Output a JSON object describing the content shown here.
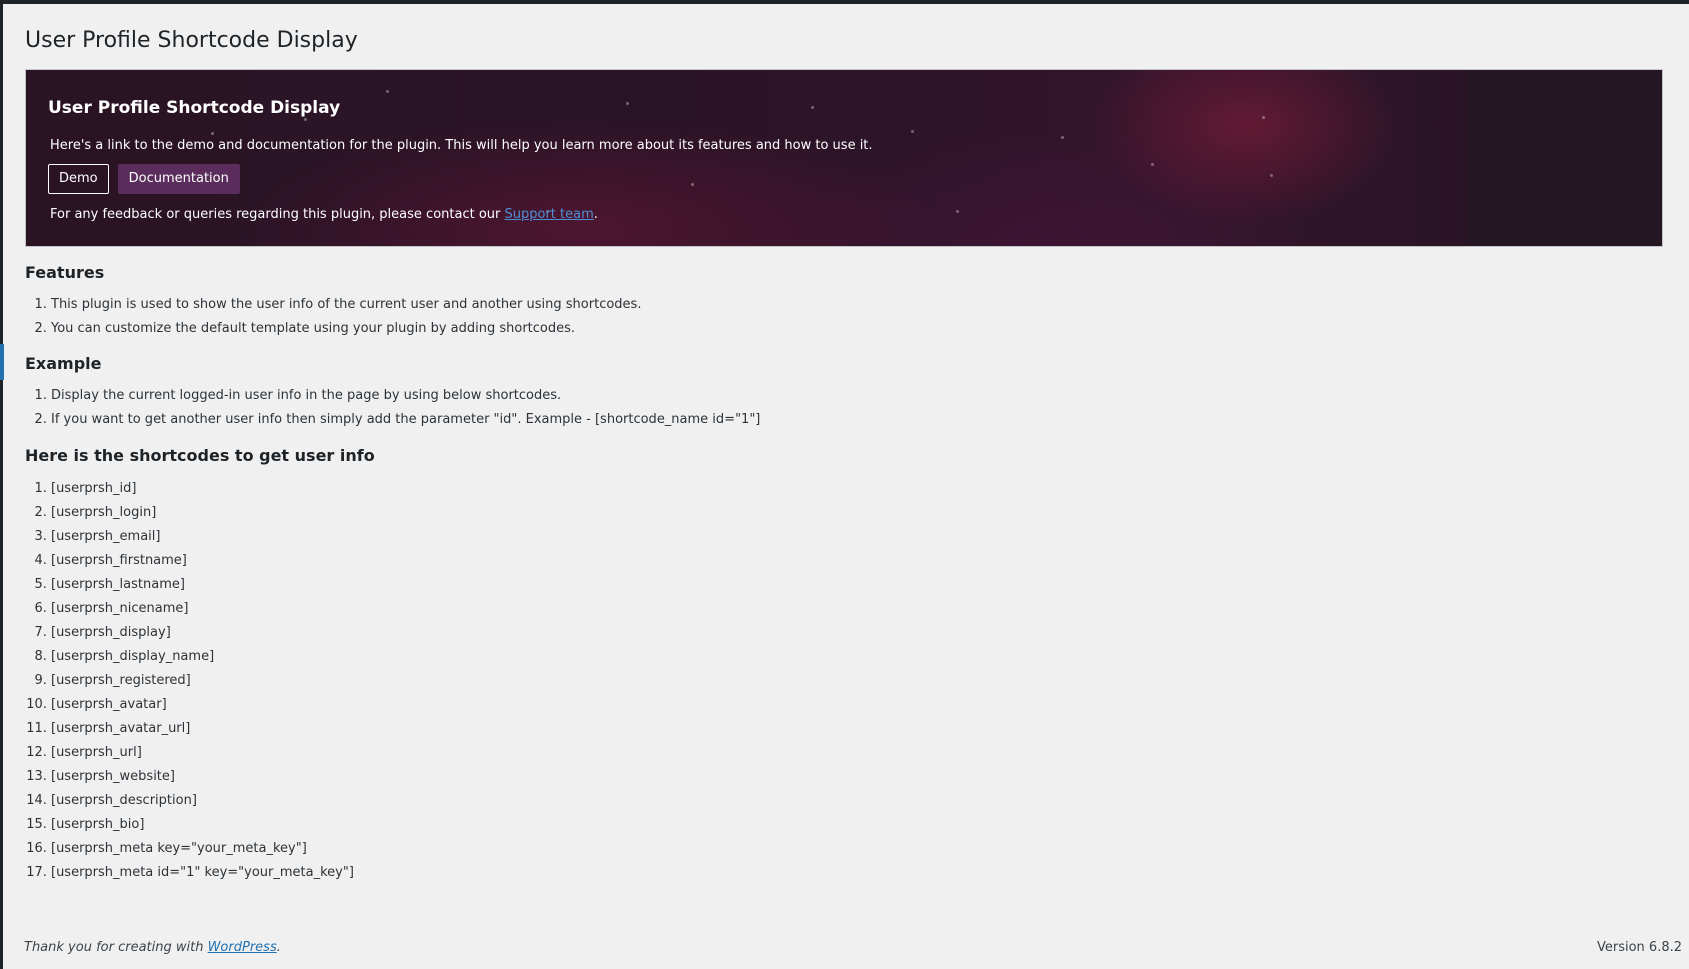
{
  "page": {
    "title": "User Profile Shortcode Display"
  },
  "banner": {
    "heading": "User Profile Shortcode Display",
    "intro": "Here's a link to the demo and documentation for the plugin. This will help you learn more about its features and how to use it.",
    "demo_label": "Demo",
    "documentation_label": "Documentation",
    "contact_prefix": "For any feedback or queries regarding this plugin, please contact our ",
    "contact_link": "Support team",
    "contact_suffix": "."
  },
  "features": {
    "title": "Features",
    "items": [
      "This plugin is used to show the user info of the current user and another using shortcodes.",
      "You can customize the default template using your plugin by adding shortcodes."
    ]
  },
  "example": {
    "title": "Example",
    "items": [
      "Display the current logged-in user info in the page by using below shortcodes.",
      "If you want to get another user info then simply add the parameter \"id\". Example - [shortcode_name id=\"1\"]"
    ]
  },
  "shortcodes": {
    "title": "Here is the shortcodes to get user info",
    "items": [
      "[userprsh_id]",
      "[userprsh_login]",
      "[userprsh_email]",
      "[userprsh_firstname]",
      "[userprsh_lastname]",
      "[userprsh_nicename]",
      "[userprsh_display]",
      "[userprsh_display_name]",
      "[userprsh_registered]",
      "[userprsh_avatar]",
      "[userprsh_avatar_url]",
      "[userprsh_url]",
      "[userprsh_website]",
      "[userprsh_description]",
      "[userprsh_bio]",
      "[userprsh_meta key=\"your_meta_key\"]",
      "[userprsh_meta id=\"1\" key=\"your_meta_key\"]"
    ]
  },
  "footer": {
    "thanks_prefix": "Thank you for creating with ",
    "wordpress_link": "WordPress",
    "thanks_suffix": ".",
    "version": "Version 6.8.2"
  },
  "colors": {
    "background": "#f0f0f1",
    "admin_bar": "#1d2327",
    "link": "#2271b1",
    "doc_button": "#5a2d5c",
    "banner_base": "#2a1424"
  }
}
